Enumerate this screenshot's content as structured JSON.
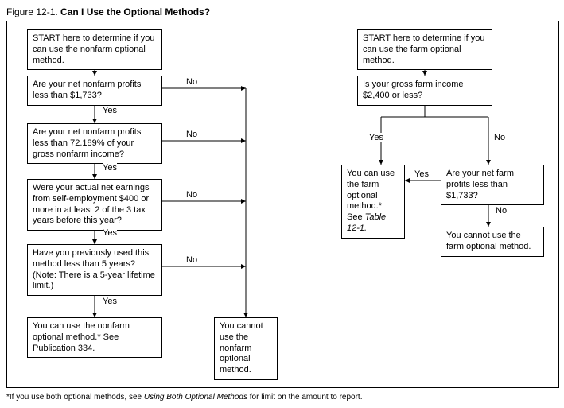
{
  "title": {
    "figure": "Figure 12-1.",
    "question": "Can I Use the Optional Methods?"
  },
  "left": {
    "start": "START here to determine if you can use the nonfarm optional method.",
    "q1": "Are your net nonfarm profits less than $1,733?",
    "q2": "Are your net nonfarm profits less than 72.189% of your gross nonfarm income?",
    "q3": "Were your actual net earnings from self-employment $400 or more in at least 2 of the 3 tax years before this year?",
    "q4": "Have you previously used this method less than 5 years? (Note: There is a 5-year lifetime limit.)",
    "yes_result": "You can use the nonfarm optional method.* See Publication 334.",
    "no_result": "You cannot use the nonfarm optional method."
  },
  "right": {
    "start": "START here to determine if you can use the farm optional method.",
    "q1": "Is your gross farm income $2,400 or less?",
    "q2": "Are your net farm profits less than $1,733?",
    "yes_result_pre": "You can use the farm optional method.* See ",
    "yes_result_ital": "Table 12-1.",
    "no_result": "You cannot use the farm optional method."
  },
  "labels": {
    "yes": "Yes",
    "no": "No"
  },
  "footnote_pre": "*If you use both optional methods, see ",
  "footnote_ital": "Using Both Optional Methods",
  "footnote_post": " for limit on the amount to report."
}
